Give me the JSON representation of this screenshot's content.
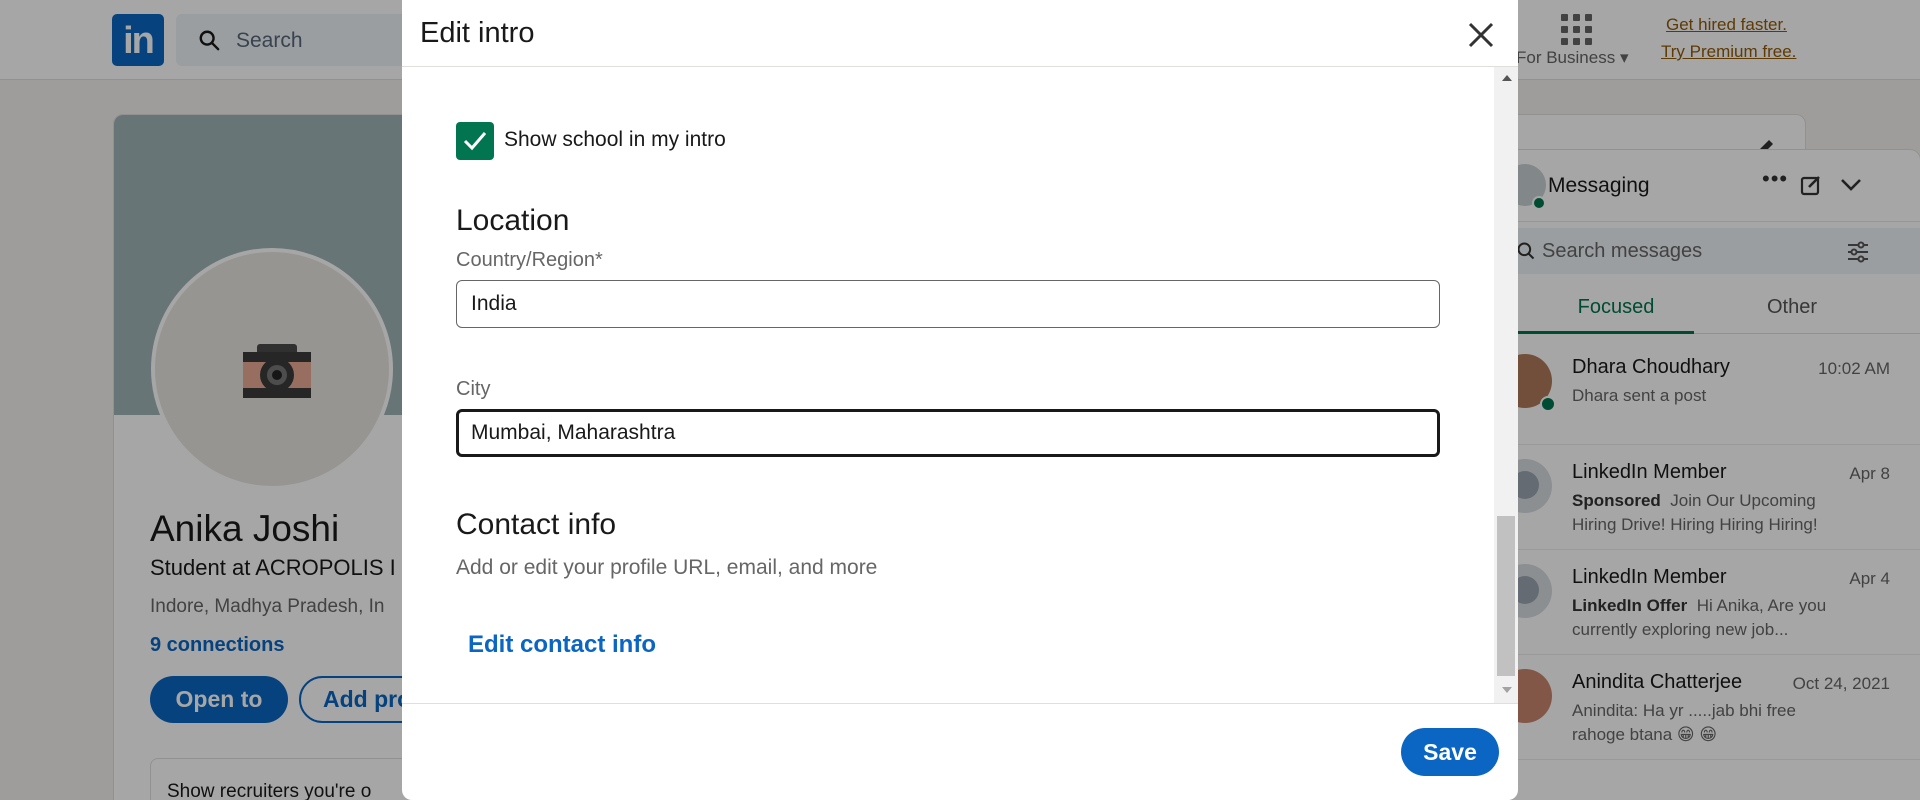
{
  "nav": {
    "logo": "in",
    "search_placeholder": "Search",
    "for_business": "For Business",
    "premium_line1": "Get hired faster.",
    "premium_line2": "Try Premium free."
  },
  "profile": {
    "name": "Anika Joshi",
    "headline": "Student at ACROPOLIS I",
    "location": "Indore, Madhya Pradesh, In",
    "connections": "9 connections",
    "open_to_button": "Open to",
    "add_profile_button": "Add pro",
    "recruiters_banner": "Show recruiters you're o"
  },
  "messaging": {
    "title": "Messaging",
    "search_placeholder": "Search messages",
    "tabs": [
      "Focused",
      "Other"
    ],
    "conversations": [
      {
        "name": "Dhara Choudhary",
        "date": "10:02 AM",
        "tag": "",
        "preview": "Dhara sent a post"
      },
      {
        "name": "LinkedIn Member",
        "date": "Apr 8",
        "tag": "Sponsored",
        "preview": "Join Our Upcoming Hiring Drive! Hiring Hiring Hiring!"
      },
      {
        "name": "LinkedIn Member",
        "date": "Apr 4",
        "tag": "LinkedIn Offer",
        "preview": "Hi Anika, Are you currently exploring new job..."
      },
      {
        "name": "Anindita Chatterjee",
        "date": "Oct 24, 2021",
        "tag": "",
        "preview": "Anindita: Ha yr .....jab bhi free rahoge btana 😁 😁"
      }
    ]
  },
  "modal": {
    "title": "Edit intro",
    "show_school_label": "Show school in my intro",
    "show_school_checked": true,
    "location_heading": "Location",
    "country_label": "Country/Region*",
    "country_value": "India",
    "city_label": "City",
    "city_value": "Mumbai, Maharashtra",
    "contact_heading": "Contact info",
    "contact_description": "Add or edit your profile URL, email, and more",
    "edit_contact_link": "Edit contact info",
    "save_button": "Save"
  },
  "colors": {
    "linkedin_blue": "#0a66c2",
    "checkbox_green": "#01754f",
    "premium_gold": "#915907"
  }
}
